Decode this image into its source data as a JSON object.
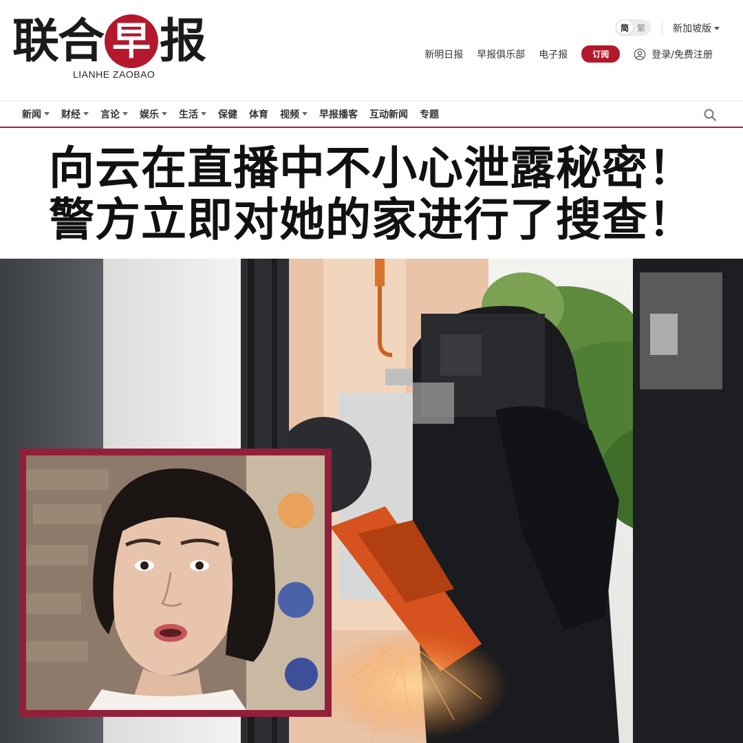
{
  "brand": {
    "name_chars": [
      "联",
      "合",
      "早",
      "报"
    ],
    "name_en": "LIANHE ZAOBAO",
    "accent_color": "#b4182d"
  },
  "header": {
    "lang_simplified": "简",
    "lang_traditional": "繁",
    "edition": "新加坡版",
    "links": [
      "新明日报",
      "早报俱乐部",
      "电子报"
    ],
    "subscribe": "订阅",
    "login": "登录/免费注册"
  },
  "nav": {
    "items": [
      {
        "label": "新闻",
        "dropdown": true
      },
      {
        "label": "财经",
        "dropdown": true
      },
      {
        "label": "言论",
        "dropdown": true
      },
      {
        "label": "娱乐",
        "dropdown": true
      },
      {
        "label": "生活",
        "dropdown": true
      },
      {
        "label": "保健",
        "dropdown": false
      },
      {
        "label": "体育",
        "dropdown": false
      },
      {
        "label": "视频",
        "dropdown": true
      },
      {
        "label": "早报播客",
        "dropdown": false
      },
      {
        "label": "互动新闻",
        "dropdown": false
      },
      {
        "label": "专题",
        "dropdown": false
      }
    ],
    "search_icon": "search-icon"
  },
  "headline": {
    "line1": "向云在直播中不小心泄露秘密！",
    "line2": "警方立即对她的家进行了搜查！"
  }
}
